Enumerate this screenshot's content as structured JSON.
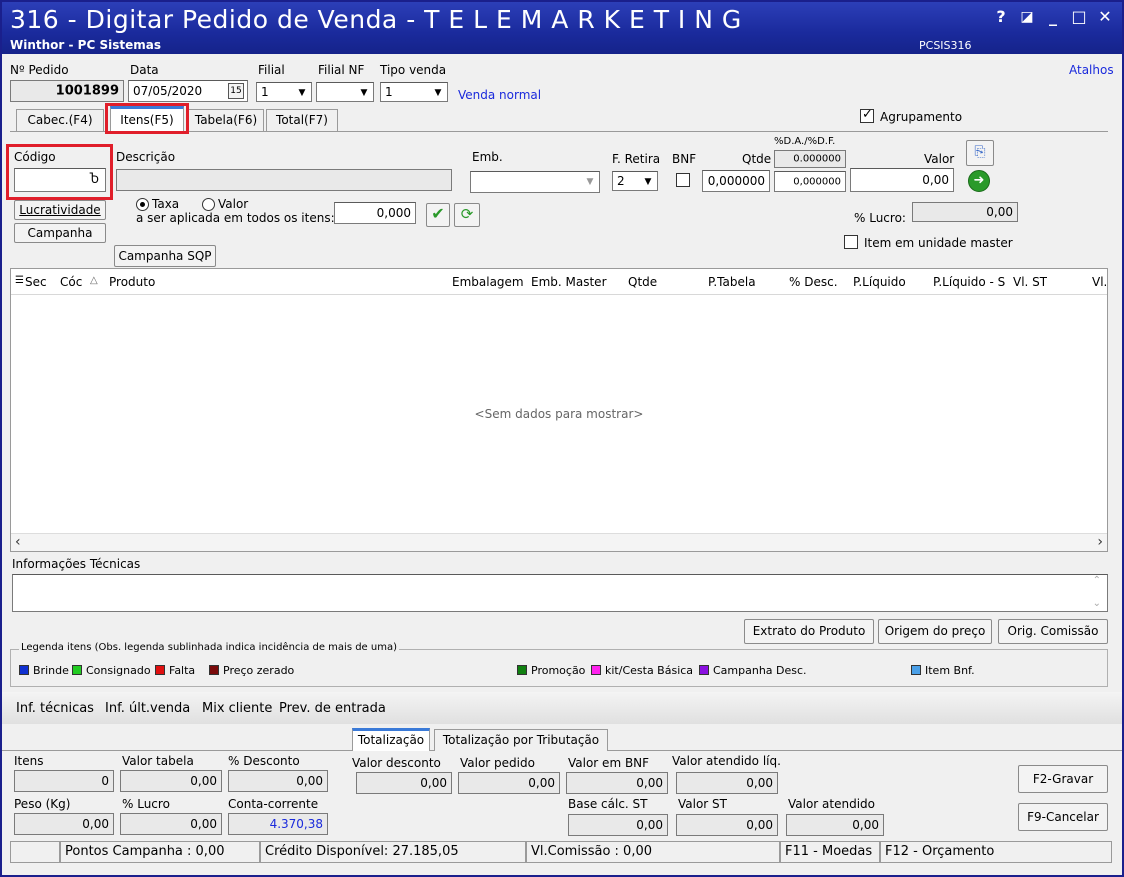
{
  "window": {
    "title": "316 - Digitar Pedido de Venda - T E L E M A R K E T I N G",
    "subtitle": "Winthor - PC Sistemas",
    "code": "PCSIS316",
    "btn_help": "?",
    "btn_min": "_",
    "btn_max": "□",
    "btn_close": "✕"
  },
  "header": {
    "pedido_label": "Nº Pedido",
    "pedido_value": "1001899",
    "data_label": "Data",
    "data_value": "07/05/2020",
    "filial_label": "Filial",
    "filial_value": "1",
    "filialnf_label": "Filial NF",
    "filialnf_value": "",
    "tipovenda_label": "Tipo venda",
    "tipovenda_value": "1",
    "tipovenda_desc": "Venda normal",
    "atalhos": "Atalhos",
    "calendar": "15"
  },
  "tabs": [
    {
      "label": "Cabec.(F4)"
    },
    {
      "label": "Itens(F5)"
    },
    {
      "label": "Tabela(F6)"
    },
    {
      "label": "Total(F7)"
    }
  ],
  "agrupamento": {
    "label": "Agrupamento",
    "checked": true
  },
  "item_form": {
    "codigo_label": "Código",
    "codigo_value": "",
    "descricao_label": "Descrição",
    "emb_label": "Emb.",
    "fretira_label": "F. Retira",
    "fretira_value": "2",
    "bnf_label": "BNF",
    "qtde_label": "Qtde",
    "qtde_value": "0,000000",
    "dadf_label": "%D.A./%D.F.",
    "dadf_value1": "0.000000",
    "dadf_value2": "0,000000",
    "valor_label": "Valor",
    "valor_value": "0,00",
    "lucratividade_btn": "Lucratividade",
    "campanha_btn": "Campanha",
    "radio_taxa": "Taxa",
    "radio_valor": "Valor",
    "aplicada_label": "a ser aplicada em todos os itens:",
    "aplicada_value": "0,000",
    "lucro_label": "% Lucro:",
    "lucro_value": "0,00",
    "item_master_label": "Item em unidade master",
    "campanha_sqp_btn": "Campanha SQP"
  },
  "grid": {
    "columns": [
      "Sec",
      "Cóc",
      "Produto",
      "Embalagem",
      "Emb. Master",
      "Qtde",
      "P.Tabela",
      "% Desc.",
      "P.Líquido",
      "P.Líquido - S",
      "Vl. ST",
      "Vl."
    ],
    "empty_text": "<Sem dados para mostrar>"
  },
  "info_tecnicas": {
    "label": "Informações Técnicas"
  },
  "action_buttons": {
    "extrato": "Extrato do Produto",
    "origem": "Origem do preço",
    "comissao": "Orig. Comissão"
  },
  "legend": {
    "title": "Legenda itens (Obs. legenda sublinhada indica incidência de mais de uma)",
    "items": [
      {
        "label": "Brinde",
        "color": "#1030d0"
      },
      {
        "label": "Consignado",
        "color": "#22cc22"
      },
      {
        "label": "Falta",
        "color": "#e01010"
      },
      {
        "label": "Preço zerado",
        "color": "#7a0a0a"
      },
      {
        "label": "Promoção",
        "color": "#108010"
      },
      {
        "label": "kit/Cesta Básica",
        "color": "#ff22ee"
      },
      {
        "label": "Campanha Desc.",
        "color": "#8a10e0"
      },
      {
        "label": "Item Bnf.",
        "color": "#4aa0e8"
      }
    ]
  },
  "bottom_links": [
    "Inf. técnicas",
    "Inf. últ.venda",
    "Mix cliente",
    "Prev. de entrada"
  ],
  "total_tabs": [
    "Totalização",
    "Totalização por Tributação"
  ],
  "totals": {
    "itens_label": "Itens",
    "itens_value": "0",
    "valor_tabela_label": "Valor tabela",
    "valor_tabela_value": "0,00",
    "desconto_label": "% Desconto",
    "desconto_value": "0,00",
    "valor_desconto_label": "Valor desconto",
    "valor_desconto_value": "0,00",
    "valor_pedido_label": "Valor pedido",
    "valor_pedido_value": "0,00",
    "valor_bnf_label": "Valor em BNF",
    "valor_bnf_value": "0,00",
    "valor_atendido_liq_label": "Valor atendido líq.",
    "valor_atendido_liq_value": "0,00",
    "peso_label": "Peso (Kg)",
    "peso_value": "0,00",
    "lucro_label": "% Lucro",
    "lucro_value": "0,00",
    "conta_corrente_label": "Conta-corrente",
    "conta_corrente_value": "4.370,38",
    "base_st_label": "Base cálc. ST",
    "base_st_value": "0,00",
    "valor_st_label": "Valor ST",
    "valor_st_value": "0,00",
    "valor_atendido_label": "Valor atendido",
    "valor_atendido_value": "0,00",
    "gravar_btn": "F2-Gravar",
    "cancelar_btn": "F9-Cancelar"
  },
  "status": {
    "pontos": "Pontos Campanha : 0,00",
    "credito": "Crédito Disponível: 27.185,05",
    "comissao": "Vl.Comissão : 0,00",
    "moedas": "F11 - Moedas",
    "orcamento": "F12 - Orçamento"
  },
  "colors": {
    "titlebar": "#1a2a9c",
    "highlight": "#e01e2a",
    "link": "#1a2adc",
    "accent_tab": "#3a7ad8"
  }
}
